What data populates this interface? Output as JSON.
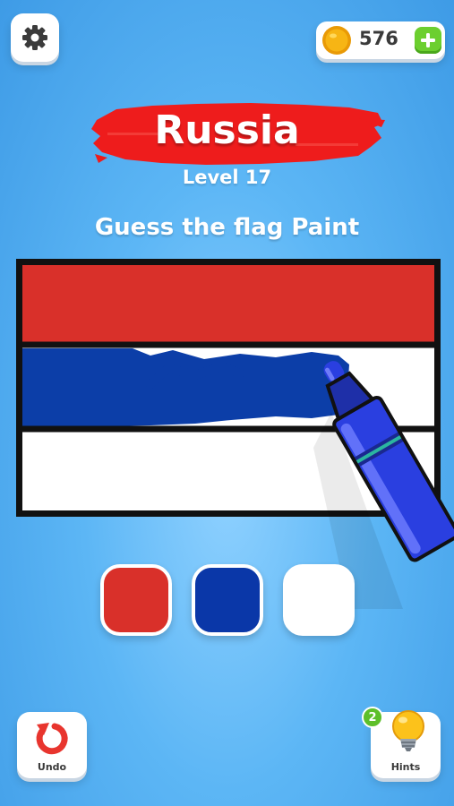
{
  "header": {
    "settings_icon": "gear-icon",
    "coins": {
      "icon": "coin-icon",
      "count": "576",
      "add_icon": "plus-icon"
    }
  },
  "puzzle": {
    "country": "Russia",
    "level": "Level 17",
    "instruction": "Guess the flag Paint"
  },
  "flag": {
    "stripes": [
      "#d9302a",
      "#ffffff",
      "#ffffff"
    ],
    "paint_color": "#0c3ea8",
    "outline_color": "#111111"
  },
  "palette": {
    "swatches": [
      {
        "name": "red",
        "color": "#d9302a"
      },
      {
        "name": "blue",
        "color": "#0a37a8"
      },
      {
        "name": "white",
        "color": "#ffffff"
      }
    ]
  },
  "footer": {
    "undo_label": "Undo",
    "undo_icon": "undo-icon",
    "hints_label": "Hints",
    "hints_icon": "lightbulb-icon",
    "hints_count": "2"
  },
  "tool": {
    "icon": "marker-icon",
    "color": "#2a3fe0"
  },
  "colors": {
    "title_brush": "#ee1c1c",
    "coin": "#f7b514",
    "accent_green": "#6ccf2f"
  }
}
